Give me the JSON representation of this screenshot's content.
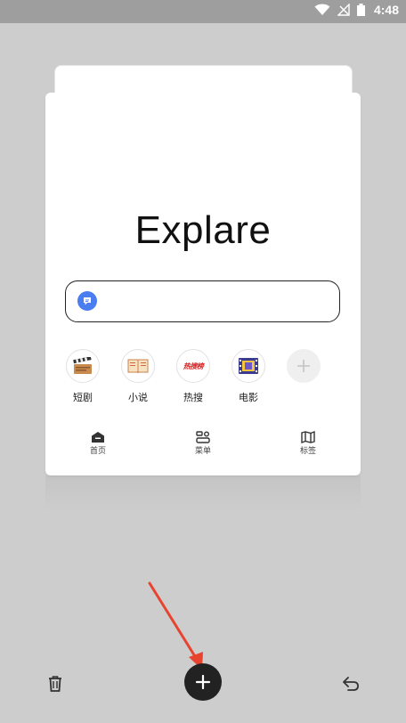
{
  "status_bar": {
    "time": "4:48"
  },
  "brand": {
    "title": "Explare"
  },
  "search": {
    "placeholder": ""
  },
  "shortcuts": [
    {
      "label": "短剧",
      "icon": "clapperboard-icon"
    },
    {
      "label": "小说",
      "icon": "book-icon"
    },
    {
      "label": "热搜",
      "icon": "hot-search-icon",
      "badge_text": "热搜榜"
    },
    {
      "label": "电影",
      "icon": "film-icon"
    },
    {
      "label": "",
      "icon": "plus-icon"
    }
  ],
  "card_nav": [
    {
      "label": "首页",
      "icon": "home-icon"
    },
    {
      "label": "菜单",
      "icon": "menu-icon"
    },
    {
      "label": "标签",
      "icon": "map-icon"
    }
  ],
  "colors": {
    "background": "#cdcdcd",
    "accent_blue": "#4a7ef0",
    "arrow_red": "#e8432f",
    "button_dark": "#222222"
  }
}
